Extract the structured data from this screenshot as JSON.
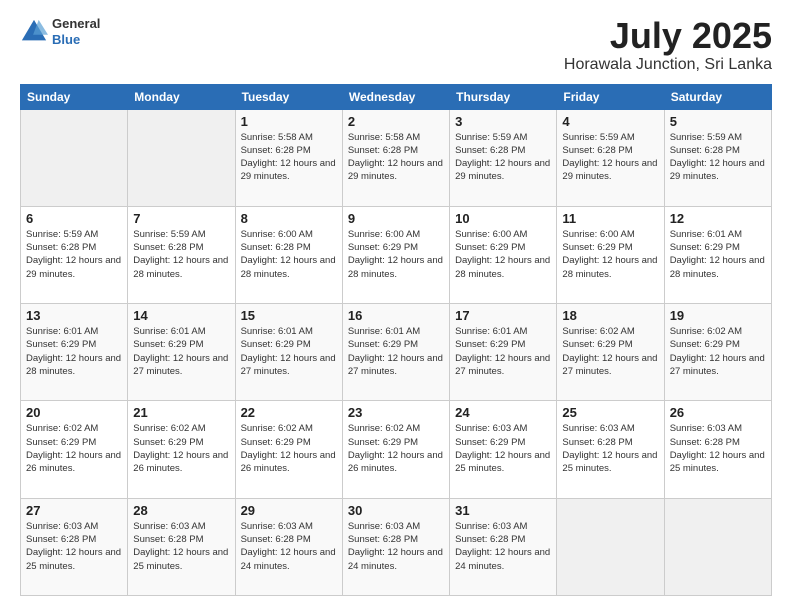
{
  "header": {
    "logo_general": "General",
    "logo_blue": "Blue",
    "title": "July 2025",
    "subtitle": "Horawala Junction, Sri Lanka"
  },
  "days_of_week": [
    "Sunday",
    "Monday",
    "Tuesday",
    "Wednesday",
    "Thursday",
    "Friday",
    "Saturday"
  ],
  "weeks": [
    [
      {
        "day": "",
        "sunrise": "",
        "sunset": "",
        "daylight": "",
        "empty": true
      },
      {
        "day": "",
        "sunrise": "",
        "sunset": "",
        "daylight": "",
        "empty": true
      },
      {
        "day": "1",
        "sunrise": "Sunrise: 5:58 AM",
        "sunset": "Sunset: 6:28 PM",
        "daylight": "Daylight: 12 hours and 29 minutes."
      },
      {
        "day": "2",
        "sunrise": "Sunrise: 5:58 AM",
        "sunset": "Sunset: 6:28 PM",
        "daylight": "Daylight: 12 hours and 29 minutes."
      },
      {
        "day": "3",
        "sunrise": "Sunrise: 5:59 AM",
        "sunset": "Sunset: 6:28 PM",
        "daylight": "Daylight: 12 hours and 29 minutes."
      },
      {
        "day": "4",
        "sunrise": "Sunrise: 5:59 AM",
        "sunset": "Sunset: 6:28 PM",
        "daylight": "Daylight: 12 hours and 29 minutes."
      },
      {
        "day": "5",
        "sunrise": "Sunrise: 5:59 AM",
        "sunset": "Sunset: 6:28 PM",
        "daylight": "Daylight: 12 hours and 29 minutes."
      }
    ],
    [
      {
        "day": "6",
        "sunrise": "Sunrise: 5:59 AM",
        "sunset": "Sunset: 6:28 PM",
        "daylight": "Daylight: 12 hours and 29 minutes."
      },
      {
        "day": "7",
        "sunrise": "Sunrise: 5:59 AM",
        "sunset": "Sunset: 6:28 PM",
        "daylight": "Daylight: 12 hours and 28 minutes."
      },
      {
        "day": "8",
        "sunrise": "Sunrise: 6:00 AM",
        "sunset": "Sunset: 6:28 PM",
        "daylight": "Daylight: 12 hours and 28 minutes."
      },
      {
        "day": "9",
        "sunrise": "Sunrise: 6:00 AM",
        "sunset": "Sunset: 6:29 PM",
        "daylight": "Daylight: 12 hours and 28 minutes."
      },
      {
        "day": "10",
        "sunrise": "Sunrise: 6:00 AM",
        "sunset": "Sunset: 6:29 PM",
        "daylight": "Daylight: 12 hours and 28 minutes."
      },
      {
        "day": "11",
        "sunrise": "Sunrise: 6:00 AM",
        "sunset": "Sunset: 6:29 PM",
        "daylight": "Daylight: 12 hours and 28 minutes."
      },
      {
        "day": "12",
        "sunrise": "Sunrise: 6:01 AM",
        "sunset": "Sunset: 6:29 PM",
        "daylight": "Daylight: 12 hours and 28 minutes."
      }
    ],
    [
      {
        "day": "13",
        "sunrise": "Sunrise: 6:01 AM",
        "sunset": "Sunset: 6:29 PM",
        "daylight": "Daylight: 12 hours and 28 minutes."
      },
      {
        "day": "14",
        "sunrise": "Sunrise: 6:01 AM",
        "sunset": "Sunset: 6:29 PM",
        "daylight": "Daylight: 12 hours and 27 minutes."
      },
      {
        "day": "15",
        "sunrise": "Sunrise: 6:01 AM",
        "sunset": "Sunset: 6:29 PM",
        "daylight": "Daylight: 12 hours and 27 minutes."
      },
      {
        "day": "16",
        "sunrise": "Sunrise: 6:01 AM",
        "sunset": "Sunset: 6:29 PM",
        "daylight": "Daylight: 12 hours and 27 minutes."
      },
      {
        "day": "17",
        "sunrise": "Sunrise: 6:01 AM",
        "sunset": "Sunset: 6:29 PM",
        "daylight": "Daylight: 12 hours and 27 minutes."
      },
      {
        "day": "18",
        "sunrise": "Sunrise: 6:02 AM",
        "sunset": "Sunset: 6:29 PM",
        "daylight": "Daylight: 12 hours and 27 minutes."
      },
      {
        "day": "19",
        "sunrise": "Sunrise: 6:02 AM",
        "sunset": "Sunset: 6:29 PM",
        "daylight": "Daylight: 12 hours and 27 minutes."
      }
    ],
    [
      {
        "day": "20",
        "sunrise": "Sunrise: 6:02 AM",
        "sunset": "Sunset: 6:29 PM",
        "daylight": "Daylight: 12 hours and 26 minutes."
      },
      {
        "day": "21",
        "sunrise": "Sunrise: 6:02 AM",
        "sunset": "Sunset: 6:29 PM",
        "daylight": "Daylight: 12 hours and 26 minutes."
      },
      {
        "day": "22",
        "sunrise": "Sunrise: 6:02 AM",
        "sunset": "Sunset: 6:29 PM",
        "daylight": "Daylight: 12 hours and 26 minutes."
      },
      {
        "day": "23",
        "sunrise": "Sunrise: 6:02 AM",
        "sunset": "Sunset: 6:29 PM",
        "daylight": "Daylight: 12 hours and 26 minutes."
      },
      {
        "day": "24",
        "sunrise": "Sunrise: 6:03 AM",
        "sunset": "Sunset: 6:29 PM",
        "daylight": "Daylight: 12 hours and 25 minutes."
      },
      {
        "day": "25",
        "sunrise": "Sunrise: 6:03 AM",
        "sunset": "Sunset: 6:28 PM",
        "daylight": "Daylight: 12 hours and 25 minutes."
      },
      {
        "day": "26",
        "sunrise": "Sunrise: 6:03 AM",
        "sunset": "Sunset: 6:28 PM",
        "daylight": "Daylight: 12 hours and 25 minutes."
      }
    ],
    [
      {
        "day": "27",
        "sunrise": "Sunrise: 6:03 AM",
        "sunset": "Sunset: 6:28 PM",
        "daylight": "Daylight: 12 hours and 25 minutes."
      },
      {
        "day": "28",
        "sunrise": "Sunrise: 6:03 AM",
        "sunset": "Sunset: 6:28 PM",
        "daylight": "Daylight: 12 hours and 25 minutes."
      },
      {
        "day": "29",
        "sunrise": "Sunrise: 6:03 AM",
        "sunset": "Sunset: 6:28 PM",
        "daylight": "Daylight: 12 hours and 24 minutes."
      },
      {
        "day": "30",
        "sunrise": "Sunrise: 6:03 AM",
        "sunset": "Sunset: 6:28 PM",
        "daylight": "Daylight: 12 hours and 24 minutes."
      },
      {
        "day": "31",
        "sunrise": "Sunrise: 6:03 AM",
        "sunset": "Sunset: 6:28 PM",
        "daylight": "Daylight: 12 hours and 24 minutes."
      },
      {
        "day": "",
        "sunrise": "",
        "sunset": "",
        "daylight": "",
        "empty": true
      },
      {
        "day": "",
        "sunrise": "",
        "sunset": "",
        "daylight": "",
        "empty": true
      }
    ]
  ]
}
